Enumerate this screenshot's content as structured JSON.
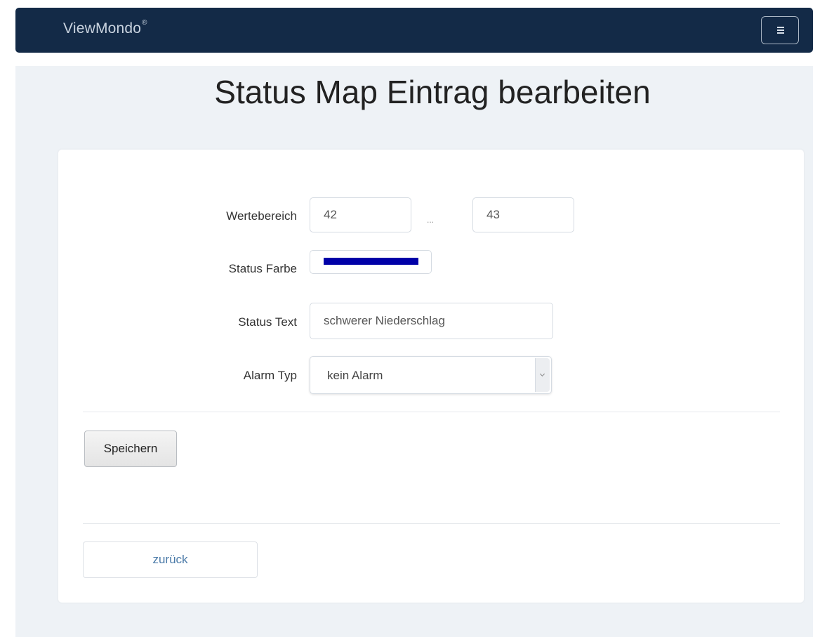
{
  "navbar": {
    "brand": "ViewMondo",
    "brand_mark": "®",
    "menu_icon": "hamburger-icon"
  },
  "page": {
    "title": "Status Map Eintrag bearbeiten"
  },
  "form": {
    "range": {
      "label": "Wertebereich",
      "min_value": "42",
      "separator": "...",
      "max_value": "43"
    },
    "color": {
      "label": "Status Farbe",
      "value": "#0000a8"
    },
    "status_text": {
      "label": "Status Text",
      "value": "schwerer Niederschlag"
    },
    "alarm_type": {
      "label": "Alarm Typ",
      "selected": "kein Alarm"
    },
    "save_label": "Speichern",
    "back_label": "zurück"
  }
}
